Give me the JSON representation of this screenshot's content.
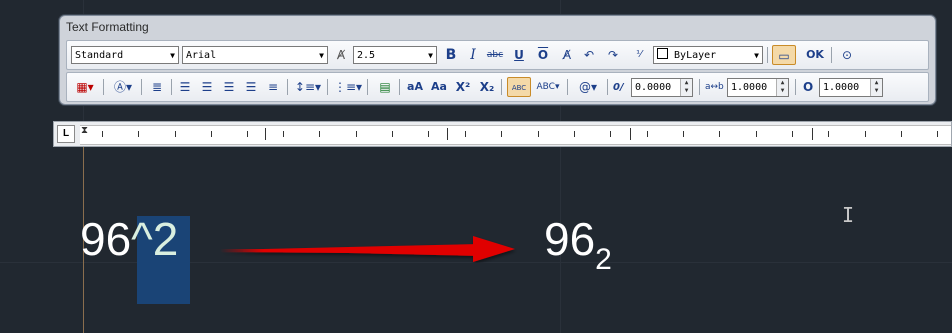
{
  "window": {
    "title": "Text Formatting"
  },
  "toolbar_row1": {
    "style": "Standard",
    "font": "Arial",
    "height": "2.5",
    "bold": "B",
    "italic": "I",
    "strikethrough": "abc",
    "underline": "U",
    "overline": "O",
    "color": "ByLayer",
    "ok": "OK"
  },
  "toolbar_row2": {
    "oblique_label": "0/",
    "oblique_value": "0.0000",
    "tracking_label": "a↔b",
    "tracking_value": "1.0000",
    "width_label": "O",
    "width_value": "1.0000",
    "insert_field": "@",
    "superscript": "X²",
    "subscript": "X₂",
    "uppercase": "aA",
    "lowercase": "Aa",
    "spell_abc": "ABC"
  },
  "ruler": {
    "corner": "L"
  },
  "canvas": {
    "source_base": "96",
    "source_caret": "^2",
    "result_base": "96",
    "result_sub": "2",
    "ibeam": "I"
  },
  "colors": {
    "background": "#212830",
    "arrow": "#e00000",
    "selection": "#1a4476",
    "toolbar": "#cfd3da"
  },
  "icons": [
    "text-style-icon",
    "font-height-icon",
    "bold-icon",
    "italic-icon",
    "strikethrough-icon",
    "underline-icon",
    "overline-icon",
    "match-format-icon",
    "undo-icon",
    "redo-icon",
    "stack-icon",
    "color-icon",
    "ruler-toggle-icon",
    "options-icon",
    "columns-icon",
    "mtext-justify-icon",
    "paragraph-icon",
    "align-left-icon",
    "align-center-icon",
    "align-right-icon",
    "justify-icon",
    "distribute-icon",
    "line-spacing-icon",
    "numbering-icon",
    "insert-field-icon",
    "uppercase-icon",
    "lowercase-icon",
    "superscript-icon",
    "subscript-icon",
    "spell-check-icon",
    "edit-dictionary-icon",
    "symbol-icon"
  ]
}
